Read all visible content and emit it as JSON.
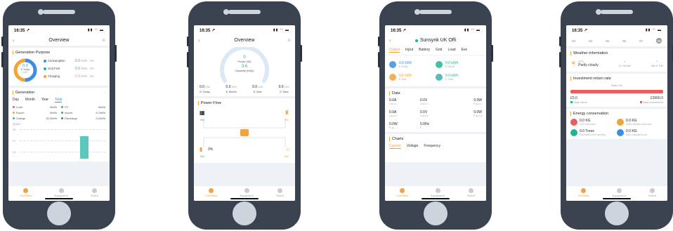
{
  "status_time": "16:35 ↗",
  "tabbar": {
    "items": [
      "Overview",
      "Equipment",
      "Event"
    ]
  },
  "phone1": {
    "title": "Overview",
    "gen_purpose_title": "Generation Purpose",
    "donut_value": "0.0",
    "donut_label": "E-Today",
    "donut_unit": "kWh",
    "legend": [
      {
        "label": "Consumption",
        "value": "0.0",
        "unit": "kWh",
        "pct": "0%",
        "color": "#3a8ee6"
      },
      {
        "label": "Grid Feel",
        "value": "0.0",
        "unit": "kWh",
        "pct": "0%",
        "color": "#1fb58f"
      },
      {
        "label": "Charging",
        "value": "0.0",
        "unit": "kWh",
        "pct": "0%",
        "color": "#f2a33a"
      }
    ],
    "generation_title": "Generation",
    "period_tabs": [
      "Day",
      "Month",
      "Year",
      "Total"
    ],
    "period_selected": "Total",
    "gen_items": [
      {
        "label": "Load",
        "value": "0kWh",
        "color": "#e85e5e"
      },
      {
        "label": "PV",
        "value": "0kWh",
        "color": "#1fb58f"
      },
      {
        "label": "Export",
        "value": "0kWh",
        "color": "#f2a33a"
      },
      {
        "label": "Import",
        "value": "6.7kWh",
        "color": "#3a8ee6"
      },
      {
        "label": "Charge",
        "value": "15.2kWh",
        "color": "#3ab0a6"
      },
      {
        "label": "Discharge",
        "value": "0.2kWh",
        "color": "#6a5acd"
      }
    ],
    "chart_unit": "(kWh)",
    "chart_ticks": [
      "20",
      "17",
      "13"
    ]
  },
  "phone2": {
    "title": "Overview",
    "gauge_power": "0",
    "gauge_power_label": "Power (W)",
    "gauge_capacity": "3.6",
    "gauge_capacity_label": "Capacity (kWp)",
    "summary": [
      {
        "value": "0.0",
        "unit": "kWh",
        "label": "E-Today"
      },
      {
        "value": "0.0",
        "unit": "kWh",
        "label": "E-Month"
      },
      {
        "value": "0.0",
        "unit": "kWh",
        "label": "E-Year"
      },
      {
        "value": "0.0",
        "unit": "kWh",
        "label": "E-Total"
      }
    ],
    "flow_title": "Power Flow",
    "flow_pv": "0W",
    "flow_grid": "0W",
    "flow_batt_pct": "0%",
    "flow_batt": "0W",
    "flow_load": "0W"
  },
  "phone3": {
    "title": "Sunsynk UK Offi",
    "tabs": [
      "Output",
      "Input",
      "Battery",
      "Grid",
      "Load",
      "Eve"
    ],
    "tab_selected": "Output",
    "stats": [
      {
        "value": "0.0 kWh",
        "label": "E-Today",
        "color": "#3a8ee6"
      },
      {
        "value": "0.0 kWh",
        "label": "E-Month",
        "color": "#1fb58f"
      },
      {
        "value": "0.0 kWh",
        "label": "E-Year",
        "color": "#f2a33a"
      },
      {
        "value": "0.0 kWh",
        "label": "E-Total",
        "color": "#3ab0a6"
      }
    ],
    "data_title": "Data",
    "data": [
      {
        "value": "0.0A",
        "label": "I-ac-L1"
      },
      {
        "value": "0.0V",
        "label": "V-ac-L1"
      },
      {
        "value": "0.0W",
        "label": "P-ac-L1"
      },
      {
        "value": "0.0A",
        "label": "I-ac-L2"
      },
      {
        "value": "0.0V",
        "label": "V-ac-L2"
      },
      {
        "value": "0.0W",
        "label": "P-ac-L2"
      },
      {
        "value": "0.0W",
        "label": "P-ac"
      },
      {
        "value": "0.0Hz",
        "label": "F"
      }
    ],
    "charts_title": "Charts",
    "chart_tabs": [
      "Current",
      "Voltage",
      "Frequency"
    ],
    "chart_tab_selected": "Current"
  },
  "phone4": {
    "dates": [
      "03",
      "04",
      "05",
      "06",
      "07",
      "08"
    ],
    "date_selected": "08",
    "weather_title": "Weather information",
    "weather_temp": "20°C",
    "weather_desc": "Partly cloudy",
    "sunrise": "07:38 AM",
    "sunset": "08:01 PM",
    "invest_title": "Investment return rate",
    "invest_ratio": "Ratio 0%",
    "invest_left_value": "£0.0",
    "invest_left_label": "Total return",
    "invest_right_value": "£3000.0",
    "invest_right_label": "Total investment",
    "energy_title": "Energy conservation",
    "energy": [
      {
        "value": "0.0 KG",
        "label": "CO2 reduction",
        "color": "#e85e5e"
      },
      {
        "value": "0.0 KG",
        "label": "Sulfur dioxide reduction",
        "color": "#f2a33a"
      },
      {
        "value": "0.0 Trees",
        "label": "Equivalent tree planting",
        "color": "#1fb58f"
      },
      {
        "value": "0.0 KG",
        "label": "Save standard coal",
        "color": "#3a8ee6"
      }
    ]
  }
}
